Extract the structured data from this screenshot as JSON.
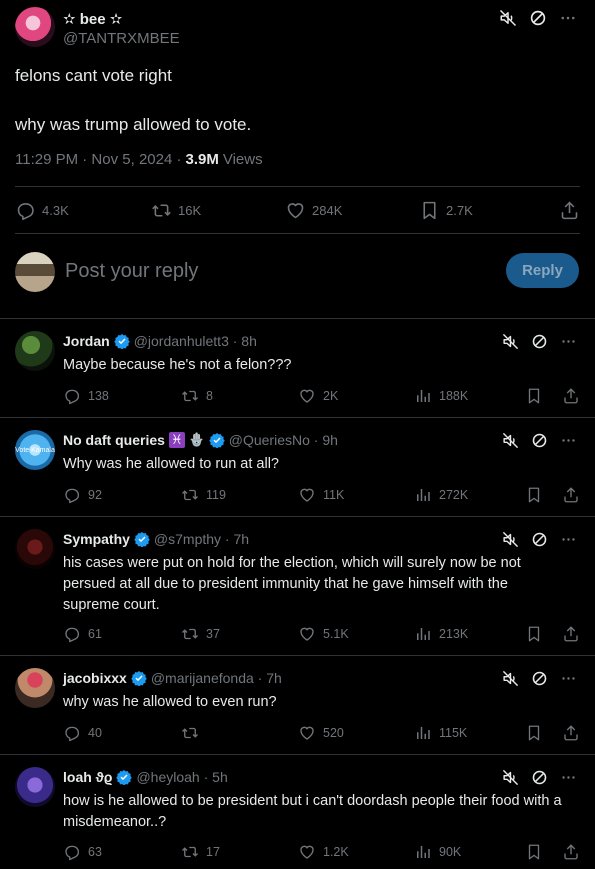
{
  "main_tweet": {
    "display_name": "✫ bee ✫",
    "handle": "@TANTRXMBEE",
    "line1": "felons cant vote right",
    "line2": "why was trump allowed to vote.",
    "time": "11:29 PM · Nov 5, 2024 ·",
    "views_count": "3.9M",
    "views_label": "Views",
    "stats": {
      "replies": "4.3K",
      "reposts": "16K",
      "likes": "284K",
      "bookmarks": "2.7K"
    }
  },
  "composer": {
    "placeholder": "Post your reply",
    "reply_button": "Reply"
  },
  "replies": [
    {
      "name": "Jordan",
      "handle": "@jordanhulett3 · 8h",
      "text": "Maybe because he's not a felon???",
      "replies": "138",
      "reposts": "8",
      "likes": "2K",
      "views": "188K"
    },
    {
      "name": "No daft queries",
      "badges": "♓",
      "hamsa": "🪬",
      "handle": "@QueriesNo · 9h",
      "text": "Why was he allowed to run at all?",
      "replies": "92",
      "reposts": "119",
      "likes": "11K",
      "views": "272K",
      "avatar_text": "Vote Kamala"
    },
    {
      "name": "Sympathy",
      "handle": "@s7mpthy · 7h",
      "text": "his cases were put on hold for the election, which will surely now be not persued at all due to president immunity that he gave himself with the supreme court.",
      "replies": "61",
      "reposts": "37",
      "likes": "5.1K",
      "views": "213K"
    },
    {
      "name": "jacobixxx",
      "handle": "@marijanefonda · 7h",
      "text": "why was he allowed to even run?",
      "replies": "40",
      "reposts": "",
      "likes": "520",
      "views": "115K"
    },
    {
      "name": "loah ϑϱ",
      "handle": "@heyloah · 5h",
      "text": "how is he allowed to be president but i can't doordash people their food with a misdemeanor..?",
      "replies": "63",
      "reposts": "17",
      "likes": "1.2K",
      "views": "90K"
    }
  ],
  "colors": {
    "accent": "#1d9bf0",
    "muted": "#71767b",
    "divider": "#2f3336",
    "reply_button": "#1a5a8c"
  },
  "icons": [
    "mute-icon",
    "block-icon",
    "more-icon",
    "reply-icon",
    "repost-icon",
    "like-icon",
    "bookmark-icon",
    "share-icon",
    "views-icon",
    "verified-icon"
  ]
}
